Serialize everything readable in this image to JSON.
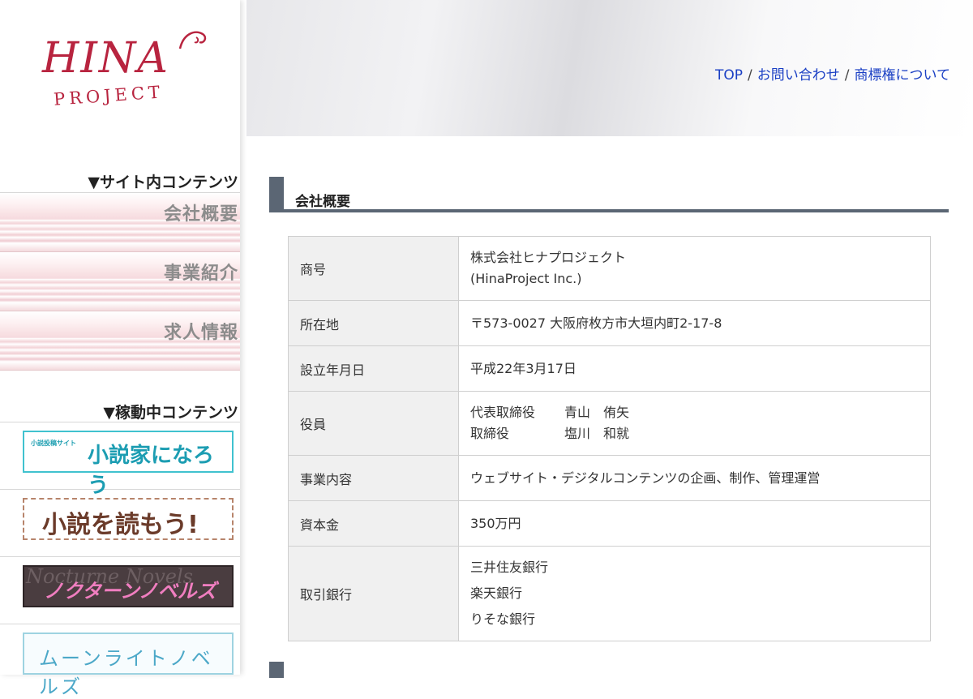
{
  "logo": {
    "word": "HINA",
    "sub": "PROJECT"
  },
  "sidebar": {
    "site_heading": "▼サイト内コンテンツ",
    "items": [
      {
        "label": "会社概要"
      },
      {
        "label": "事業紹介"
      },
      {
        "label": "求人情報"
      }
    ],
    "active_heading": "▼稼動中コンテンツ",
    "banners": [
      {
        "small": "小説投稿サイト",
        "title": "小説家になろう"
      },
      {
        "title": "小説を読もう!"
      },
      {
        "ghost": "Nocturne Novels",
        "title": "ノクターンノベルズ"
      },
      {
        "title": "ムーンライトノベルズ"
      }
    ]
  },
  "breadcrumb": {
    "top": "TOP",
    "contact": "お問い合わせ",
    "trademark": "商標権について",
    "separator": "/"
  },
  "section": {
    "title": "会社概要"
  },
  "company": {
    "rows": [
      {
        "key": "商号",
        "lines": [
          "株式会社ヒナプロジェクト",
          "(HinaProject Inc.)"
        ]
      },
      {
        "key": "所在地",
        "lines": [
          "〒573-0027 大阪府枚方市大垣内町2-17-8"
        ]
      },
      {
        "key": "設立年月日",
        "lines": [
          "平成22年3月17日"
        ]
      },
      {
        "key": "役員",
        "officers": [
          {
            "role": "代表取締役",
            "name": "青山　侑矢"
          },
          {
            "role": "取締役",
            "name": "塩川　和就"
          }
        ]
      },
      {
        "key": "事業内容",
        "lines": [
          "ウェブサイト・デジタルコンテンツの企画、制作、管理運営"
        ]
      },
      {
        "key": "資本金",
        "lines": [
          "350万円"
        ]
      },
      {
        "key": "取引銀行",
        "lines": [
          "三井住友銀行",
          "楽天銀行",
          "りそな銀行"
        ]
      }
    ]
  },
  "colors": {
    "brand": "#b8243f",
    "link": "#1a3fc4",
    "section_bar": "#5b6674"
  }
}
